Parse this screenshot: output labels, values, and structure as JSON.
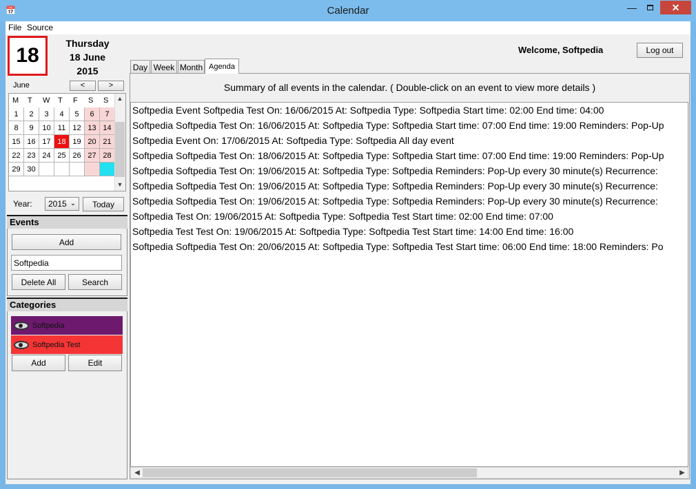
{
  "window": {
    "title": "Calendar",
    "icon": "calendar-app-icon",
    "minimize": "—",
    "close": "✕"
  },
  "menu": [
    "File",
    "Source"
  ],
  "date": {
    "day_number": "18",
    "weekday": "Thursday",
    "day_month": "18 June",
    "year": "2015"
  },
  "mini_calendar": {
    "month": "June",
    "prev": "<",
    "next": ">",
    "weekdays": [
      "M",
      "T",
      "W",
      "T",
      "F",
      "S",
      "S"
    ],
    "weeks": [
      [
        "1",
        "2",
        "3",
        "4",
        "5",
        "6",
        "7"
      ],
      [
        "8",
        "9",
        "10",
        "11",
        "12",
        "13",
        "14"
      ],
      [
        "15",
        "16",
        "17",
        "18",
        "19",
        "20",
        "21"
      ],
      [
        "22",
        "23",
        "24",
        "25",
        "26",
        "27",
        "28"
      ],
      [
        "29",
        "30",
        "",
        "",
        "",
        "",
        ""
      ]
    ],
    "selected_day": "18",
    "year_label": "Year:",
    "year_value": "2015",
    "today_label": "Today"
  },
  "events": {
    "header": "Events",
    "add_label": "Add",
    "search_value": "Softpedia",
    "delete_all_label": "Delete All",
    "search_label": "Search"
  },
  "categories": {
    "header": "Categories",
    "items": [
      {
        "name": "Softpedia",
        "color": "#6d1a6e"
      },
      {
        "name": "Softpedia Test",
        "color": "#f53535"
      }
    ],
    "add_label": "Add",
    "edit_label": "Edit"
  },
  "header": {
    "welcome": "Welcome, Softpedia",
    "logout_label": "Log out"
  },
  "tabs": [
    "Day",
    "Week",
    "Month",
    "Agenda"
  ],
  "active_tab": "Agenda",
  "agenda": {
    "summary": "Summary of all events in the calendar. ( Double-click on an event to view more details )",
    "events": [
      "Softpedia Event Softpedia Test On: 16/06/2015 At: Softpedia Type: Softpedia Start time: 02:00 End time: 04:00",
      "Softpedia Softpedia Test On: 16/06/2015 At: Softpedia Type: Softpedia Start time: 07:00 End time: 19:00 Reminders:  Pop-Up",
      "Softpedia Event  On: 17/06/2015 At: Softpedia Type: Softpedia  All day event",
      "Softpedia Softpedia Test On: 18/06/2015 At: Softpedia Type: Softpedia Start time: 07:00 End time: 19:00 Reminders:  Pop-Up",
      "Softpedia Softpedia Test On: 19/06/2015 At: Softpedia Type: Softpedia  Reminders:  Pop-Up every 30 minute(s)  Recurrence:",
      "Softpedia Softpedia Test On: 19/06/2015 At: Softpedia Type: Softpedia  Reminders:  Pop-Up every 30 minute(s)  Recurrence:",
      "Softpedia Softpedia Test On: 19/06/2015 At: Softpedia Type: Softpedia  Reminders:  Pop-Up every 30 minute(s)  Recurrence:",
      "Softpedia Test  On: 19/06/2015 At: Softpedia Type: Softpedia Test Start time: 02:00 End time: 07:00",
      "Softpedia Test Test On: 19/06/2015 At: Softpedia Type: Softpedia Test Start time: 14:00 End time: 16:00",
      "Softpedia Softpedia Test On: 20/06/2015 At: Softpedia Type: Softpedia Test Start time: 06:00 End time: 18:00 Reminders:  Po"
    ]
  }
}
